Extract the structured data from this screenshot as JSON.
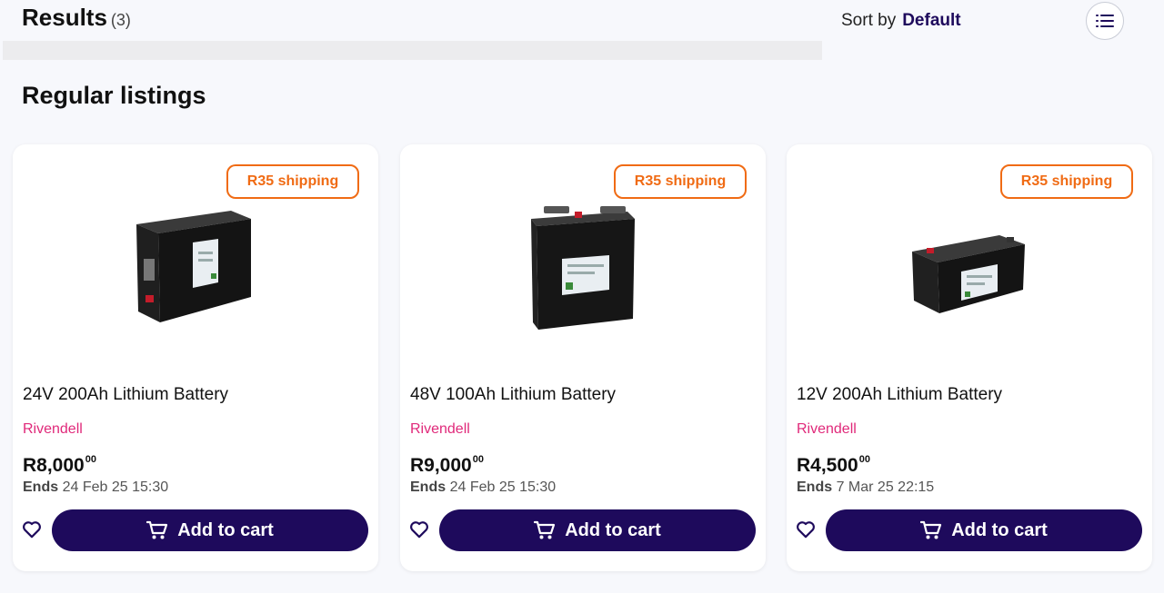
{
  "header": {
    "results_label": "Results",
    "results_count": "(3)",
    "sort_label": "Sort by",
    "sort_value": "Default"
  },
  "section_title": "Regular listings",
  "colors": {
    "primary": "#1e0a5c",
    "shipping_badge": "#f06b14",
    "seller": "#e0297a"
  },
  "listings": [
    {
      "badge": "R35 shipping",
      "title": "24V 200Ah Lithium Battery",
      "seller": "Rivendell",
      "price_main": "R8,000",
      "price_cents": "00",
      "ends_label": "Ends",
      "ends_value": "24 Feb 25 15:30",
      "cart_label": "Add to cart",
      "image": "battery-box-icon"
    },
    {
      "badge": "R35 shipping",
      "title": "48V 100Ah Lithium Battery",
      "seller": "Rivendell",
      "price_main": "R9,000",
      "price_cents": "00",
      "ends_label": "Ends",
      "ends_value": "24 Feb 25 15:30",
      "cart_label": "Add to cart",
      "image": "battery-tall-icon"
    },
    {
      "badge": "R35 shipping",
      "title": "12V 200Ah Lithium Battery",
      "seller": "Rivendell",
      "price_main": "R4,500",
      "price_cents": "00",
      "ends_label": "Ends",
      "ends_value": "7 Mar 25 22:15",
      "cart_label": "Add to cart",
      "image": "battery-flat-icon"
    }
  ]
}
